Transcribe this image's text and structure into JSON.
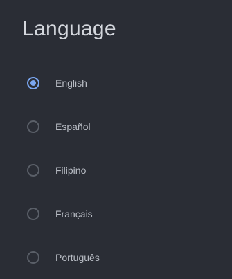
{
  "page": {
    "title": "Language"
  },
  "options": [
    {
      "label": "English",
      "selected": true
    },
    {
      "label": "Español",
      "selected": false
    },
    {
      "label": "Filipino",
      "selected": false
    },
    {
      "label": "Français",
      "selected": false
    },
    {
      "label": "Português",
      "selected": false
    }
  ],
  "colors": {
    "background": "#2a2d35",
    "accent": "#7aa7f2",
    "radio_border": "#5a5f68",
    "title_text": "#d4d7dd",
    "label_text": "#b8bcc4"
  }
}
